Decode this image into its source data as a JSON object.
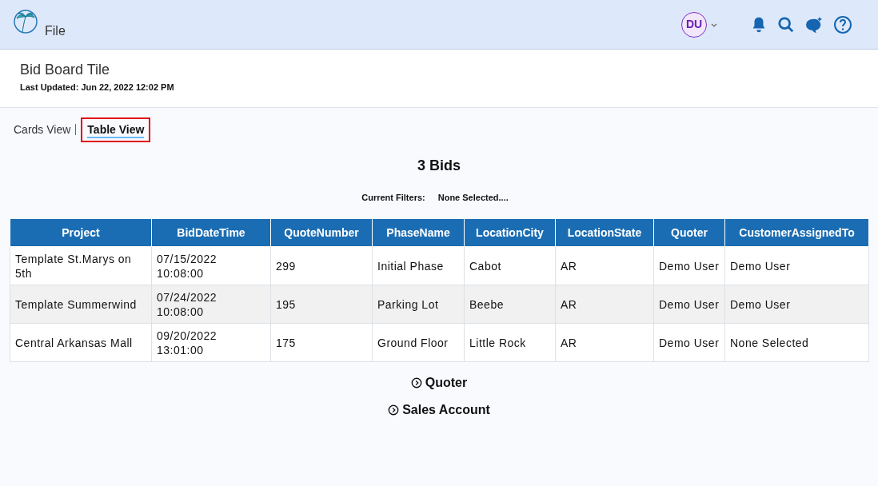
{
  "header": {
    "menu_label": "File",
    "avatar": "DU"
  },
  "page": {
    "title": "Bid Board Tile",
    "last_updated": "Last Updated: Jun 22, 2022 12:02 PM"
  },
  "tabs": [
    {
      "label": "Cards View",
      "selected": false
    },
    {
      "label": "Table View",
      "selected": true
    }
  ],
  "summary": {
    "count": "3 Bids",
    "filters_label": "Current Filters:",
    "filters_value": "None Selected...."
  },
  "table": {
    "columns": [
      "Project",
      "BidDateTime",
      "QuoteNumber",
      "PhaseName",
      "LocationCity",
      "LocationState",
      "Quoter",
      "CustomerAssignedTo"
    ],
    "rows": [
      [
        "Template St.Marys on 5th",
        "07/15/2022 10:08:00",
        "299",
        "Initial Phase",
        "Cabot",
        "AR",
        "Demo User",
        "Demo User"
      ],
      [
        "Template Summerwind",
        "07/24/2022 10:08:00",
        "195",
        "Parking Lot",
        "Beebe",
        "AR",
        "Demo User",
        "Demo User"
      ],
      [
        "Central Arkansas Mall",
        "09/20/2022 13:01:00",
        "175",
        "Ground Floor",
        "Little Rock",
        "AR",
        "Demo User",
        "None Selected"
      ]
    ]
  },
  "sections": [
    {
      "label": "Quoter",
      "expanded": false
    },
    {
      "label": "Sales Account",
      "expanded": false
    }
  ]
}
